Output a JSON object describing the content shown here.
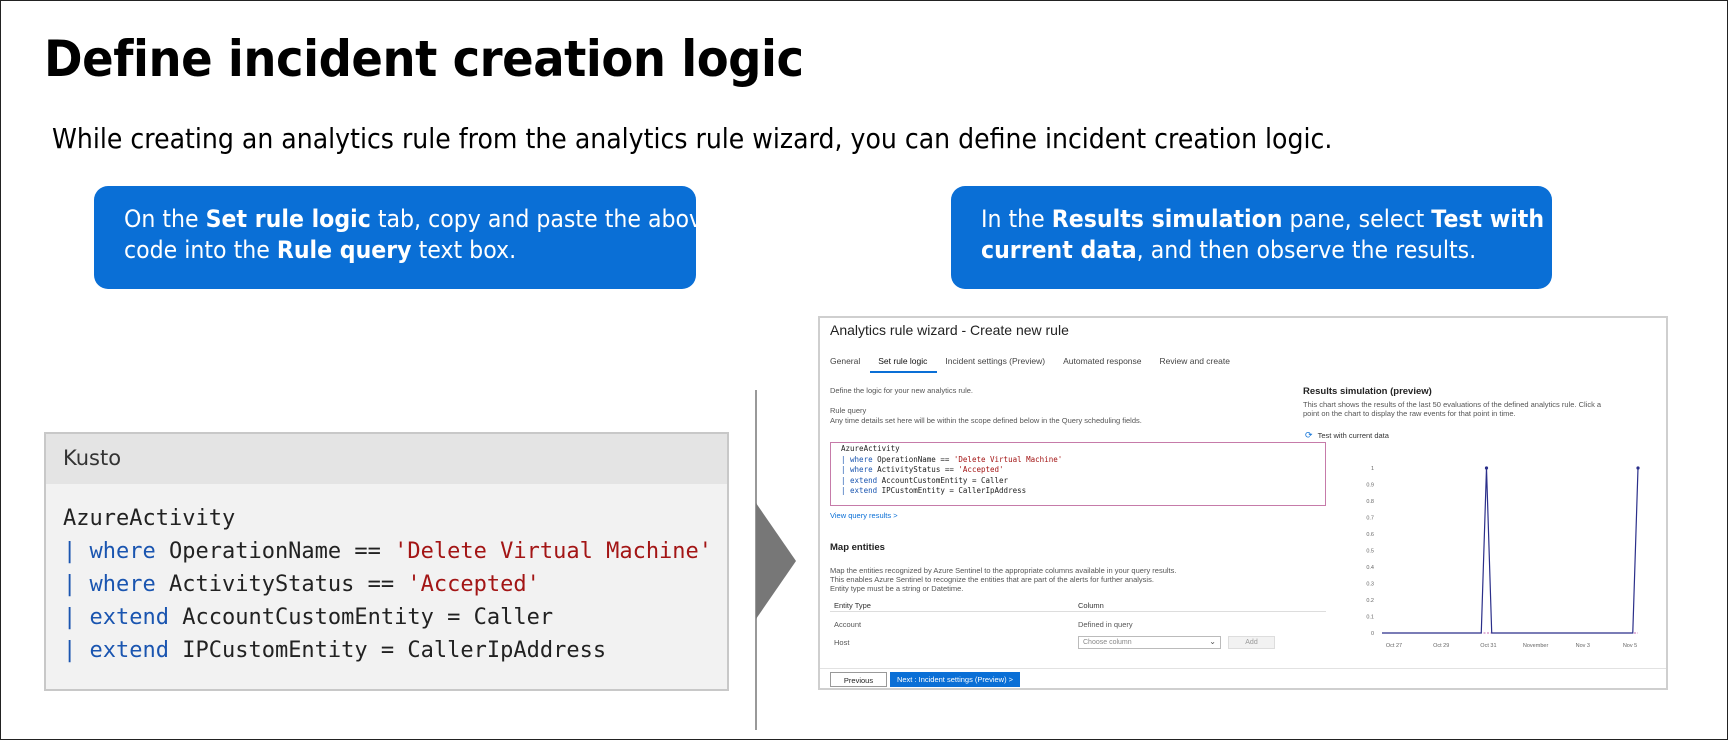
{
  "slide": {
    "title": "Define incident creation logic",
    "subtitle": "While creating an analytics rule from the analytics rule wizard, you can define incident creation logic."
  },
  "callouts": {
    "left": {
      "p1": "On the ",
      "b1": "Set rule logic",
      "p2": " tab, copy and paste the above",
      "p3": "code into the ",
      "b2": "Rule query",
      "p4": " text box."
    },
    "right": {
      "p1": "In the ",
      "b1": "Results simulation",
      "p2": " pane, select ",
      "b2": "Test with",
      "b3": "current data",
      "p3": ", and then observe the results."
    },
    "accent_color": "#0a6fd6"
  },
  "code": {
    "language": "Kusto",
    "lines": [
      {
        "pipe": "",
        "kw": "",
        "text": "AzureActivity",
        "str": ""
      },
      {
        "pipe": "| ",
        "kw": "where",
        "text": " OperationName == ",
        "str": "'Delete Virtual Machine'"
      },
      {
        "pipe": "| ",
        "kw": "where",
        "text": " ActivityStatus == ",
        "str": "'Accepted'"
      },
      {
        "pipe": "| ",
        "kw": "extend",
        "text": " AccountCustomEntity = Caller",
        "str": ""
      },
      {
        "pipe": "| ",
        "kw": "extend",
        "text": " IPCustomEntity = CallerIpAddress",
        "str": ""
      }
    ]
  },
  "wizard": {
    "title": "Analytics rule wizard - Create new rule",
    "tabs": [
      "General",
      "Set rule logic",
      "Incident settings (Preview)",
      "Automated response",
      "Review and create"
    ],
    "active_tab": "Set rule logic",
    "intro": "Define the logic for your new analytics rule.",
    "rule_query_label": "Rule query",
    "rule_query_hint": "Any time details set here will be within the scope defined below in the Query scheduling fields.",
    "view_results_link": "View query results >",
    "map_entities": {
      "heading": "Map entities",
      "desc1": "Map the entities recognized by Azure Sentinel to the appropriate columns available in your query results.",
      "desc2": "This enables Azure Sentinel to recognize the entities that are part of the alerts for further analysis.",
      "desc3": "Entity type must be a string or Datetime.",
      "col_entity": "Entity Type",
      "col_column": "Column",
      "rows": [
        {
          "entity": "Account",
          "column": "Defined in query"
        },
        {
          "entity": "Host",
          "column": ""
        }
      ],
      "choose_placeholder": "Choose column",
      "add_label": "Add"
    },
    "results_sim": {
      "heading": "Results simulation (preview)",
      "desc1": "This chart shows the results of the last 50 evaluations of the defined analytics rule. Click a",
      "desc2": "point on the chart to display the raw events for that point in time.",
      "test_link": "Test with current data"
    },
    "buttons": {
      "previous": "Previous",
      "next": "Next : Incident settings (Preview) >"
    }
  },
  "chart_data": {
    "type": "line",
    "y_ticks": [
      "1",
      "0.9",
      "0.8",
      "0.7",
      "0.6",
      "0.5",
      "0.4",
      "0.3",
      "0.2",
      "0.1",
      "0"
    ],
    "x_ticks": [
      "Oct 27",
      "Oct 29",
      "Oct 31",
      "November",
      "Nov 3",
      "Nov 5"
    ],
    "ylim": [
      0,
      1
    ],
    "series": [
      {
        "color": "#2b2f8a",
        "values": [
          0,
          0,
          0,
          0,
          0,
          0,
          0,
          0,
          0,
          0,
          0,
          0,
          0,
          0,
          0,
          0,
          0,
          0,
          0,
          0,
          1,
          0,
          0,
          0,
          0,
          0,
          0,
          0,
          0,
          0,
          0,
          0,
          0,
          0,
          0,
          0,
          0,
          0,
          0,
          0,
          0,
          0,
          0,
          0,
          0,
          0,
          0,
          0,
          0,
          1
        ]
      }
    ]
  }
}
